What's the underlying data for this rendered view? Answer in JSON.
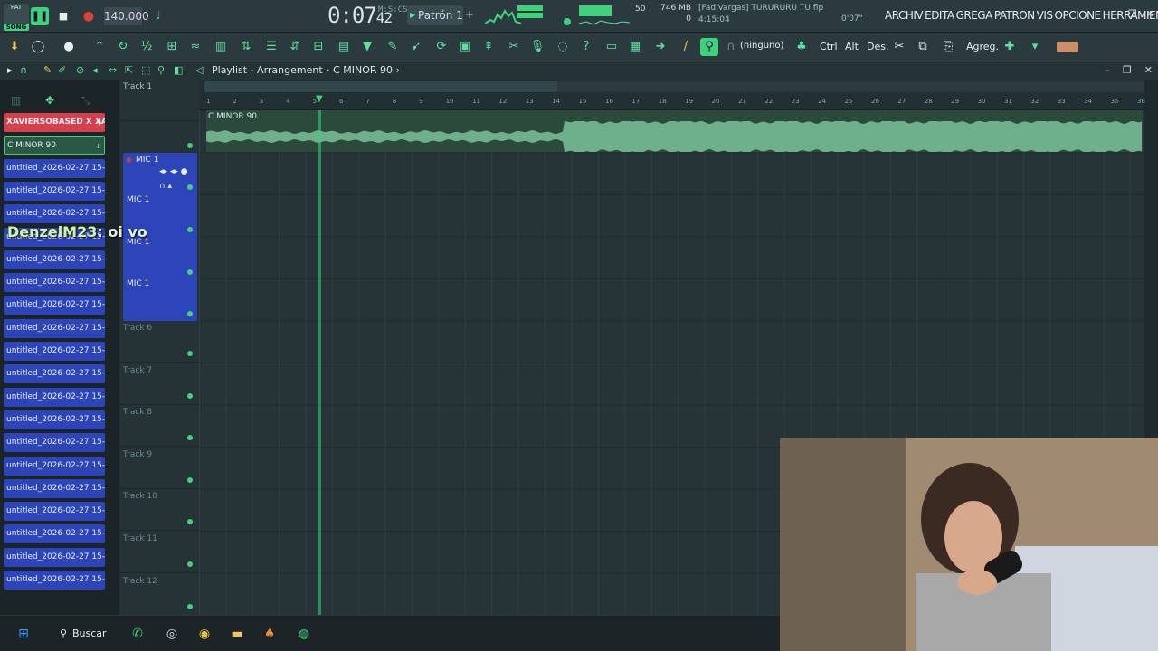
{
  "transport": {
    "mode_top": "PAT",
    "mode_song": "SONG",
    "play_icon": "pause-icon",
    "stop_icon": "stop-icon",
    "record_icon": "record-icon",
    "bpm": "140.000",
    "time_main": "0:07",
    "time_sub": "42",
    "time_units": "M:S:CS",
    "pattern": "Patrón 1",
    "pattern_add": "+",
    "cpu_value": "50",
    "mem_value": "746 MB",
    "mem_sub": "0",
    "hint_user": "[FadiVargas] TURURURU TU.flp",
    "hint_time": "4:15:04",
    "time_readout": "0'07\""
  },
  "menu": {
    "items": [
      "ARCHIV",
      "EDITA",
      "GREGA",
      "PATRON",
      "VIS",
      "OPCIONE",
      "HERRAMIENTA"
    ]
  },
  "window": {
    "min": "–",
    "restore": "❐",
    "close": "✕"
  },
  "toolbar": {
    "snap_label": "(ninguno)",
    "ctrl": "Ctrl",
    "alt": "Alt",
    "des": "Des.",
    "agreg": "Agreg."
  },
  "playlist": {
    "title": "Playlist - Arrangement",
    "separator": "›",
    "pattern_name": "C MINOR 90",
    "caret": "›"
  },
  "patterns": {
    "items": [
      "XAVIERSOBASED X XAV...",
      "C MINOR 90",
      "untitled_2026-02-27 15-...",
      "untitled_2026-02-27 15-...",
      "untitled_2026-02-27 15-...",
      "untitled_2026-02-27 15-...",
      "untitled_2026-02-27 15-...",
      "untitled_2026-02-27 15-...",
      "untitled_2026-02-27 15-...",
      "untitled_2026-02-27 15-...",
      "untitled_2026-02-27 15-...",
      "untitled_2026-02-27 15-...",
      "untitled_2026-02-27 15-...",
      "untitled_2026-02-27 15-...",
      "untitled_2026-02-27 15-...",
      "untitled_2026-02-27 15-...",
      "untitled_2026-02-27 15-...",
      "untitled_2026-02-27 15-...",
      "untitled_2026-02-27 15-...",
      "untitled_2026-02-27 15-...",
      "untitled_2026-02-27 15-..."
    ]
  },
  "tracks": {
    "track1": "Track 1",
    "mic_labels": [
      "MIC 1",
      "MIC 1",
      "MIC 1",
      "MIC 1"
    ],
    "rest": [
      "Track 6",
      "Track 7",
      "Track 8",
      "Track 9",
      "Track 10",
      "Track 11",
      "Track 12"
    ]
  },
  "ruler": {
    "bars": [
      "1",
      "2",
      "3",
      "4",
      "5",
      "6",
      "7",
      "8",
      "9",
      "10",
      "11",
      "12",
      "13",
      "14",
      "15",
      "16",
      "17",
      "18",
      "19",
      "20",
      "21",
      "22",
      "23",
      "24",
      "25",
      "26",
      "27",
      "28",
      "29",
      "30",
      "31",
      "32",
      "33",
      "34",
      "35",
      "36"
    ]
  },
  "clip": {
    "name": "C MINOR 90"
  },
  "chat": {
    "user": "DenzelM23",
    "message": ": oi vo"
  },
  "taskbar": {
    "search": "Buscar",
    "apps": [
      "windows-start-icon",
      "whatsapp-icon",
      "obs-icon",
      "chrome-icon",
      "file-explorer-icon",
      "fl-studio-icon",
      "spotify-icon"
    ]
  },
  "colors": {
    "accent_green": "#3fd27a",
    "pattern_blue": "#2d45b8",
    "pattern_red": "#d6404c",
    "background": "#263438"
  }
}
